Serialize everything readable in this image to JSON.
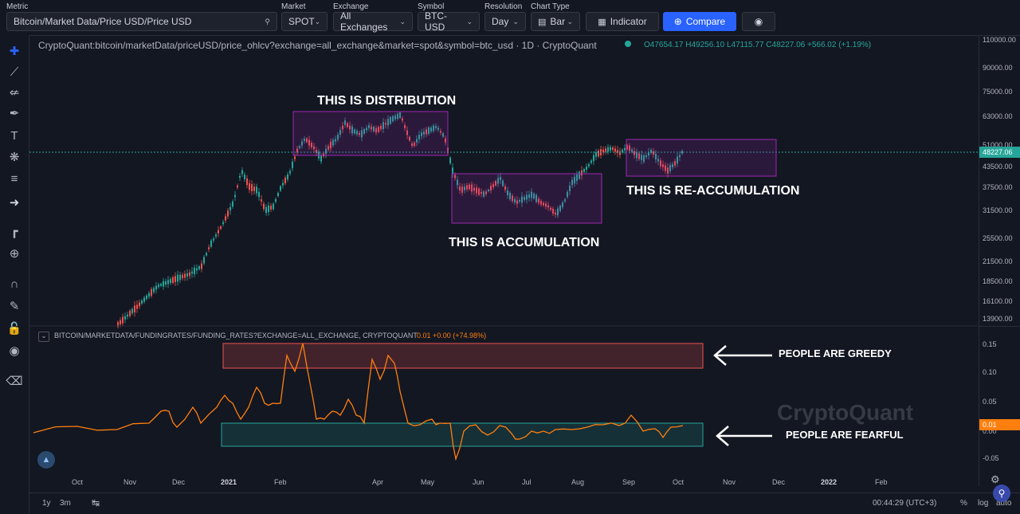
{
  "toolbar": {
    "metric_label": "Metric",
    "metric_value": "Bitcoin/Market Data/Price USD/Price USD",
    "market_label": "Market",
    "market_value": "SPOT",
    "exchange_label": "Exchange",
    "exchange_value": "All Exchanges",
    "symbol_label": "Symbol",
    "symbol_value": "BTC-USD",
    "resolution_label": "Resolution",
    "resolution_value": "Day",
    "charttype_label": "Chart Type",
    "charttype_value": "Bar",
    "indicator_label": "Indicator",
    "compare_label": "Compare"
  },
  "chart": {
    "symbol_line": "CryptoQuant:bitcoin/marketData/priceUSD/price_ohlcv?exchange=all_exchange&market=spot&symbol=btc_usd · 1D · CryptoQuant",
    "ohlc": "O47654.17  H49256.10  L47115.77  C48227.06  +566.02 (+1.19%)",
    "current_price": "48227.06",
    "price_ticks": [
      "110000.00",
      "90000.00",
      "75000.00",
      "63000.00",
      "51000.00",
      "43500.00",
      "37500.00",
      "31500.00",
      "25500.00",
      "21500.00",
      "18500.00",
      "16100.00",
      "13900.00"
    ],
    "indicator_line": "BITCOIN/MARKETDATA/FUNDINGRATES/FUNDING_RATES?EXCHANGE=ALL_EXCHANGE, CRYPTOQUANT",
    "indicator_value": "0.01  +0.00 (+74.98%)",
    "funding_ticks": [
      "0.15",
      "0.10",
      "0.05",
      "0.00",
      "-0.05"
    ],
    "funding_current": "0.01",
    "watermark": "CryptoQuant",
    "annotations": {
      "distribution": "THIS IS DISTRIBUTION",
      "accumulation": "THIS IS ACCUMULATION",
      "reaccumulation": "THIS IS RE-ACCUMULATION",
      "greedy": "PEOPLE ARE GREEDY",
      "fearful": "PEOPLE ARE FEARFUL"
    },
    "x_labels": [
      "Oct",
      "Nov",
      "Dec",
      "2021",
      "Feb",
      "Apr",
      "May",
      "Jun",
      "Jul",
      "Aug",
      "Sep",
      "Oct",
      "Nov",
      "Dec",
      "2022",
      "Feb"
    ]
  },
  "bottom": {
    "range_1y": "1y",
    "range_3m": "3m",
    "time": "00:44:29 (UTC+3)",
    "pct": "%",
    "log": "log",
    "auto": "auto"
  },
  "colors": {
    "up": "#26a69a",
    "down": "#ef5350",
    "funding": "#ff7f0e",
    "accent": "#2962ff"
  }
}
